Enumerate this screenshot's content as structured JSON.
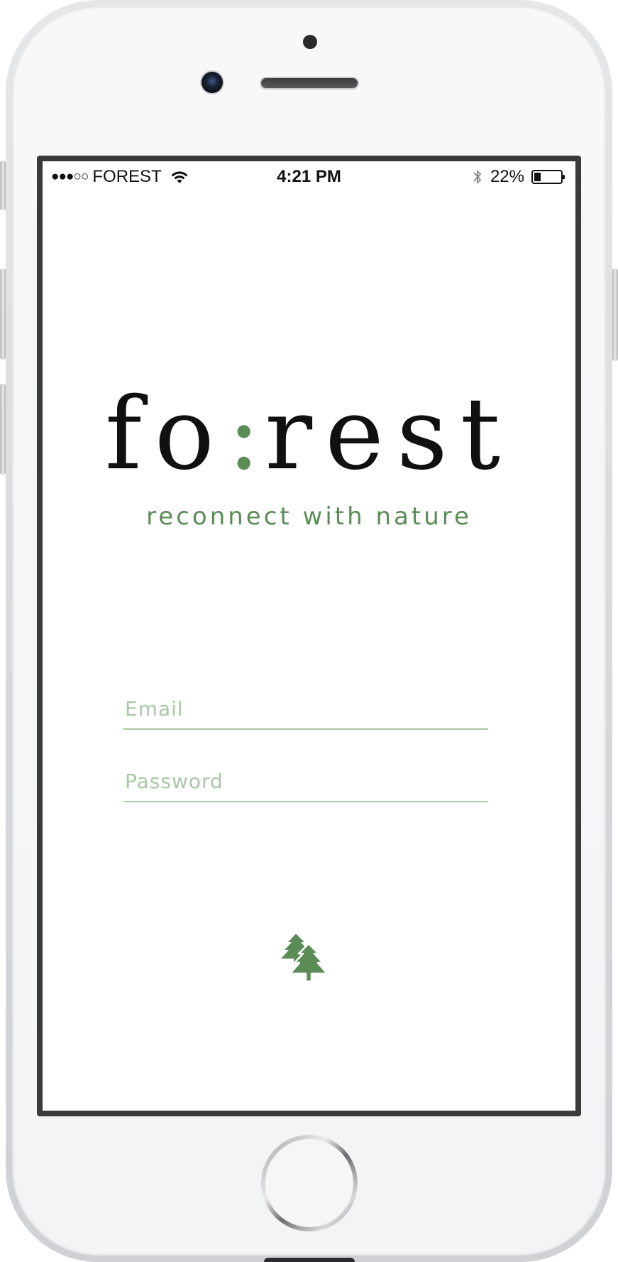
{
  "statusbar": {
    "signal": "●●●○○",
    "carrier": "FOREST",
    "time": "4:21 PM",
    "battery": "22%"
  },
  "logo": {
    "part1": "fo",
    "colon": ":",
    "part2": "rest",
    "tagline": "reconnect with nature"
  },
  "form": {
    "email_placeholder": "Email",
    "password_placeholder": "Password"
  },
  "icons": {
    "wifi": "wifi-icon",
    "bluetooth": "bluetooth-icon",
    "battery": "battery-icon",
    "submit": "pine-trees-icon"
  },
  "colors": {
    "accent": "#5b8c56",
    "field_line": "#a9c8a5"
  }
}
